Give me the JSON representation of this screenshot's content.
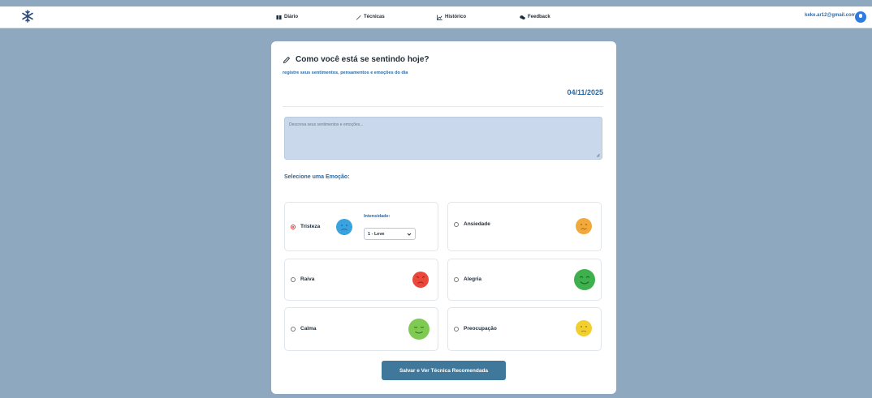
{
  "nav": {
    "items": [
      {
        "label": "Diário",
        "icon": "book-icon"
      },
      {
        "label": "Técnicas",
        "icon": "brush-icon"
      },
      {
        "label": "Histórico",
        "icon": "chart-icon"
      },
      {
        "label": "Feedback",
        "icon": "chat-icon"
      }
    ]
  },
  "user": {
    "email": "keke.ar12@gmail.com"
  },
  "card": {
    "title": "Como você está se sentindo hoje?",
    "subtitle": "registre seus sentimentos, pensamentos e emoções do dia",
    "date": "04/11/2025",
    "textarea_placeholder": "Descreva seus sentimentos e emoções...",
    "select_label": "Selecione uma Emoção:",
    "intensity_label": "Intensidade:",
    "intensity_value": "1 - Leve",
    "submit_label": "Salvar e Ver Técnica Recomendada"
  },
  "emotions": [
    {
      "label": "Tristeza",
      "color": "#3aa3df",
      "checked": true
    },
    {
      "label": "Ansiedade",
      "color": "#f2a93b",
      "checked": false
    },
    {
      "label": "Raiva",
      "color": "#e9483b",
      "checked": false
    },
    {
      "label": "Alegria",
      "color": "#3fb04e",
      "checked": false
    },
    {
      "label": "Calma",
      "color": "#7fca52",
      "checked": false
    },
    {
      "label": "Preocupação",
      "color": "#f2cf2f",
      "checked": false
    }
  ],
  "colors": {
    "accent": "#2a6aa5",
    "button": "#3f789b",
    "background": "#8ea9bf"
  }
}
